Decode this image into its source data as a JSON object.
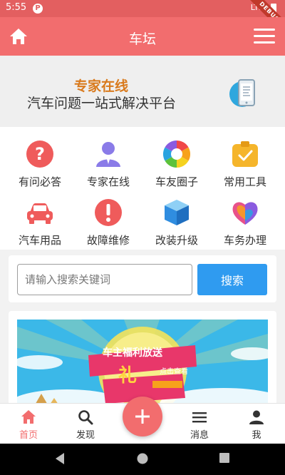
{
  "status_bar": {
    "time": "5:55",
    "network": "LTE",
    "debug_label": "DEBUG"
  },
  "app_bar": {
    "title": "车坛",
    "home_icon": "home-icon",
    "menu_icon": "hamburger-menu-icon"
  },
  "hero": {
    "line1": "专家在线",
    "line2": "汽车问题一站式解决平台"
  },
  "grid": {
    "items": [
      {
        "label": "有问必答",
        "icon": "question-icon",
        "color": "#ef5b5b"
      },
      {
        "label": "专家在线",
        "icon": "expert-icon",
        "color": "#8a7be8"
      },
      {
        "label": "车友圈子",
        "icon": "aperture-icon",
        "color": "#29a3e0"
      },
      {
        "label": "常用工具",
        "icon": "clipboard-check-icon",
        "color": "#f5b52b"
      },
      {
        "label": "汽车用品",
        "icon": "car-icon",
        "color": "#ef5b5b"
      },
      {
        "label": "故障维修",
        "icon": "warning-icon",
        "color": "#ef5b5b"
      },
      {
        "label": "改装升级",
        "icon": "box-icon",
        "color": "#2f8de0"
      },
      {
        "label": "车务办理",
        "icon": "heart-shapes-icon",
        "color": "#e8528a"
      }
    ]
  },
  "search": {
    "placeholder": "请输入搜索关键词",
    "value": "",
    "button_label": "搜索"
  },
  "promo": {
    "title": "车主福利放送",
    "gift": "礼",
    "click": "点击查看"
  },
  "bottom_nav": {
    "items": [
      {
        "label": "首页",
        "icon": "home-icon",
        "active": true
      },
      {
        "label": "发现",
        "icon": "search-icon",
        "active": false
      },
      {
        "label": "消息",
        "icon": "list-icon",
        "active": false
      },
      {
        "label": "我",
        "icon": "person-icon",
        "active": false
      }
    ],
    "fab_icon": "plus-icon"
  },
  "colors": {
    "primary": "#f26d6e",
    "search_button": "#2f9bf0",
    "hero_accent": "#d97a1d"
  }
}
